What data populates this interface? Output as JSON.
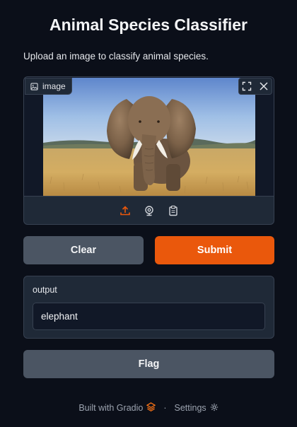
{
  "app": {
    "title": "Animal Species Classifier",
    "description": "Upload an image to classify animal species."
  },
  "image_input": {
    "label": "image",
    "icons": [
      "image-icon",
      "fullscreen-icon",
      "close-icon"
    ],
    "sources": [
      "upload-icon",
      "webcam-icon",
      "clipboard-icon"
    ],
    "active_source": "upload",
    "photo_subject": "elephant"
  },
  "buttons": {
    "clear": "Clear",
    "submit": "Submit",
    "flag": "Flag"
  },
  "output": {
    "label": "output",
    "value": "elephant"
  },
  "footer": {
    "built_with": "Built with Gradio",
    "separator": "·",
    "settings": "Settings"
  },
  "colors": {
    "background": "#0b0f19",
    "panel": "#1f2937",
    "accent": "#ea580c",
    "secondary_button": "#4b5563"
  }
}
